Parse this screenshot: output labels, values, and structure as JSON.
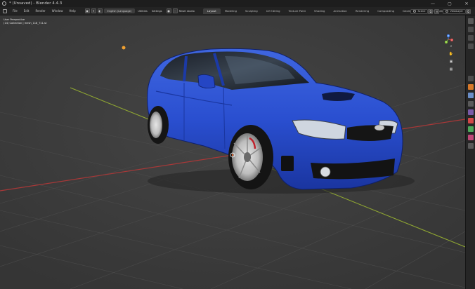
{
  "window": {
    "title": "* (Unsaved) - Blender 4.4.3",
    "controls": {
      "minimize": "—",
      "maximize": "▢",
      "close": "✕"
    }
  },
  "menu": {
    "items": [
      "File",
      "Edit",
      "Render",
      "Window",
      "Help"
    ]
  },
  "toolbar": {
    "mode": "Object Mode",
    "view": "View",
    "add": "Add",
    "object": "Object",
    "language": "English (Language)",
    "utilities": "Utilities",
    "settings": "Settings",
    "reset_studio": "Reset studio"
  },
  "workspaces": {
    "tabs": [
      "Layout",
      "Modeling",
      "Sculpting",
      "UV Editing",
      "Texture Paint",
      "Shading",
      "Animation",
      "Rendering",
      "Compositing",
      "Geometry Nodes",
      "Scripting"
    ],
    "add_label": "+"
  },
  "header_right": {
    "scene_label": "Scene",
    "view_layer_label": "ViewLayer"
  },
  "viewport": {
    "perspective": "User Perspective",
    "collection": "(14) Collection | mesh_118_T11.st"
  },
  "gizmo": {
    "x": "X",
    "y": "Y",
    "z": "Z"
  },
  "colors": {
    "car_body": "#2a4fd0",
    "grid_red_axis": "#a83838",
    "grid_green_axis": "#8fa632",
    "viewport_bg": "#3c3c3c",
    "light_dot": "#f0a030"
  },
  "sidebar_icons": [
    "tool-icon",
    "view-icon",
    "item-icon",
    "scene-icon",
    "world-icon",
    "object-icon",
    "modifier-icon",
    "particles-icon",
    "physics-icon",
    "constraints-icon",
    "data-icon",
    "material-icon",
    "texture-icon"
  ]
}
